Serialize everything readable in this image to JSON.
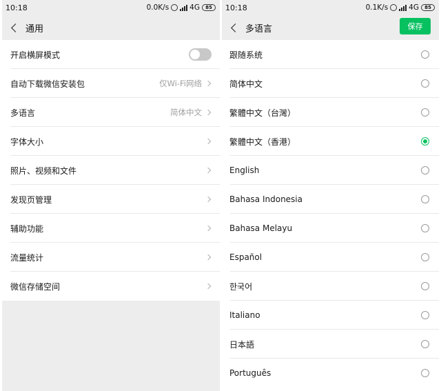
{
  "left": {
    "status": {
      "time": "10:18",
      "speed": "0.0K/s",
      "network": "4G",
      "battery": "85"
    },
    "nav": {
      "title": "通用"
    },
    "items": [
      {
        "label": "开启横屏模式",
        "value": "",
        "control": "toggle"
      },
      {
        "label": "自动下载微信安装包",
        "value": "仅Wi-Fi网络",
        "control": "chevron"
      },
      {
        "label": "多语言",
        "value": "简体中文",
        "control": "chevron"
      },
      {
        "label": "字体大小",
        "value": "",
        "control": "chevron"
      },
      {
        "label": "照片、视频和文件",
        "value": "",
        "control": "chevron"
      },
      {
        "label": "发现页管理",
        "value": "",
        "control": "chevron"
      },
      {
        "label": "辅助功能",
        "value": "",
        "control": "chevron"
      },
      {
        "label": "流量统计",
        "value": "",
        "control": "chevron"
      },
      {
        "label": "微信存储空间",
        "value": "",
        "control": "chevron"
      }
    ]
  },
  "right": {
    "status": {
      "time": "10:18",
      "speed": "0.1K/s",
      "network": "4G",
      "battery": "85"
    },
    "nav": {
      "title": "多语言",
      "save_label": "保存"
    },
    "languages": [
      {
        "label": "跟随系统",
        "selected": false
      },
      {
        "label": "简体中文",
        "selected": false
      },
      {
        "label": "繁體中文（台灣）",
        "selected": false
      },
      {
        "label": "繁體中文（香港）",
        "selected": true
      },
      {
        "label": "English",
        "selected": false
      },
      {
        "label": "Bahasa Indonesia",
        "selected": false
      },
      {
        "label": "Bahasa Melayu",
        "selected": false
      },
      {
        "label": "Español",
        "selected": false
      },
      {
        "label": "한국어",
        "selected": false
      },
      {
        "label": "Italiano",
        "selected": false
      },
      {
        "label": "日本語",
        "selected": false
      },
      {
        "label": "Português",
        "selected": false
      }
    ]
  },
  "colors": {
    "accent": "#07c160",
    "background": "#ededed"
  }
}
